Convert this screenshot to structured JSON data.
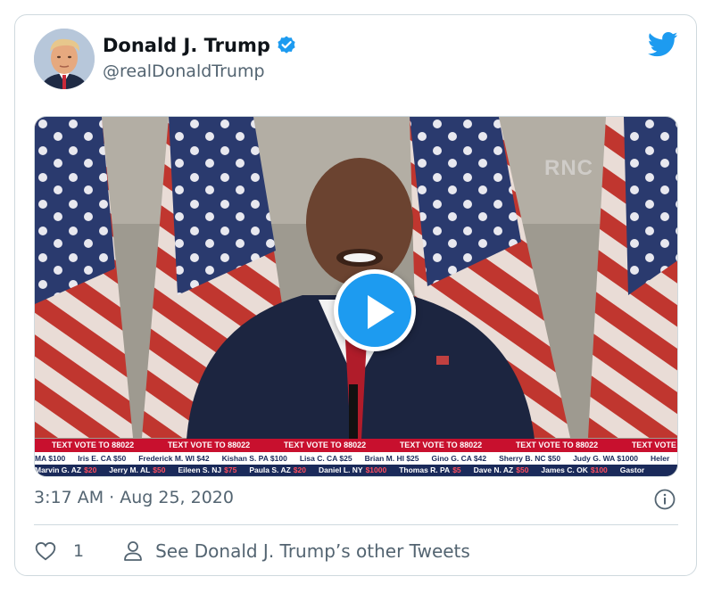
{
  "tweet": {
    "display_name": "Donald J. Trump",
    "handle": "@realDonaldTrump",
    "timestamp": "3:17 AM · Aug 25, 2020",
    "like_count": "1",
    "other_tweets_label": "See Donald J. Trump’s other Tweets"
  },
  "video": {
    "watermark": "RNC",
    "ticker_headline": "TEXT VOTE TO 88022",
    "ticker_row1": [
      "MA $100",
      "Iris E. CA $50",
      "Frederick M. WI $42",
      "Kishan S. PA $100",
      "Lisa C. CA $25",
      "Brian M. HI $25",
      "Gino G. CA $42",
      "Sherry B. NC $50",
      "Judy G. WA $1000",
      "Heler"
    ],
    "ticker_row2": [
      {
        "name": "Marvin G. AZ",
        "amt": "$20"
      },
      {
        "name": "Jerry M. AL",
        "amt": "$50"
      },
      {
        "name": "Eileen S. NJ",
        "amt": "$75"
      },
      {
        "name": "Paula S. AZ",
        "amt": "$20"
      },
      {
        "name": "Daniel L. NY",
        "amt": "$1000"
      },
      {
        "name": "Thomas R. PA",
        "amt": "$5"
      },
      {
        "name": "Dave N. AZ",
        "amt": "$50"
      },
      {
        "name": "James C. OK",
        "amt": "$100"
      },
      {
        "name": "Gastor",
        "amt": ""
      }
    ]
  },
  "colors": {
    "accent": "#1d9bf0",
    "text_secondary": "#536471",
    "ticker_red": "#c8102e",
    "ticker_navy": "#1a2a5a"
  },
  "icons": {
    "verified": "verified-badge-icon",
    "brand": "twitter-bird-icon",
    "info": "info-icon",
    "like": "heart-icon",
    "person": "person-icon",
    "play": "play-icon"
  }
}
